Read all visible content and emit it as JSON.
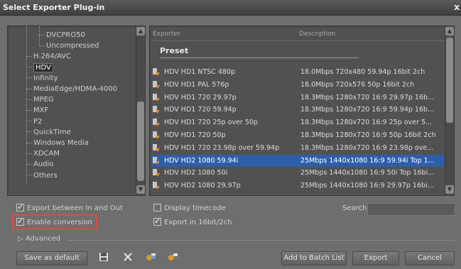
{
  "window": {
    "title": "Select Exporter Plug-in",
    "close": "x"
  },
  "tree": {
    "items": [
      {
        "label": "DVCPRO50",
        "level": 2
      },
      {
        "label": "Uncompressed",
        "level": 2
      },
      {
        "label": "H.264/AVC",
        "level": 1
      },
      {
        "label": "HDV",
        "level": 1,
        "selected": true
      },
      {
        "label": "Infinity",
        "level": 1
      },
      {
        "label": "MediaEdge/HDMA-4000",
        "level": 1
      },
      {
        "label": "MPEG",
        "level": 1
      },
      {
        "label": "MXF",
        "level": 1
      },
      {
        "label": "P2",
        "level": 1
      },
      {
        "label": "QuickTime",
        "level": 1
      },
      {
        "label": "Windows Media",
        "level": 1
      },
      {
        "label": "XDCAM",
        "level": 1
      },
      {
        "label": "Audio",
        "level": 1
      },
      {
        "label": "Others",
        "level": 1
      }
    ]
  },
  "list": {
    "col_exporter": "Exporter",
    "col_description": "Description",
    "group": "Preset",
    "rows": [
      {
        "name": "HDV HD1 NTSC 480p",
        "desc": "18.0Mbps 720x480 59.94p 16bit 2ch"
      },
      {
        "name": "HDV HD1 PAL 576p",
        "desc": "18.0Mbps 720x576 50p 16bit 2ch"
      },
      {
        "name": "HDV HD1 720 29.97p",
        "desc": "18.3Mbps 1280x720 16:9 29.97p 16b..."
      },
      {
        "name": "HDV HD1 720 59.94p",
        "desc": "18.3Mbps 1280x720 16:9 59.94p 16b..."
      },
      {
        "name": "HDV HD1 720 25p over 50p",
        "desc": "18.3Mbps 1280x720 16:9 25p over 5..."
      },
      {
        "name": "HDV HD1 720 50p",
        "desc": "18.3Mbps 1280x720 16:9 50p 16bit 2ch"
      },
      {
        "name": "HDV HD1 720 23.98p over 59.94p",
        "desc": "18.3Mbps 1280x720 16:9 23.98p ove..."
      },
      {
        "name": "HDV HD2 1080 59.94i",
        "desc": "25Mbps 1440x1080 16:9 59.94i Top 1...",
        "selected": true
      },
      {
        "name": "HDV HD2 1080 50i",
        "desc": "25Mbps 1440x1080 16:9 50i Top 16bi..."
      },
      {
        "name": "HDV HD2 1080 29.97p",
        "desc": "25Mbps 1440x1080 16:9 29.97p 16bi..."
      }
    ]
  },
  "options": {
    "export_in_out": {
      "label": "Export between In and Out",
      "checked": true
    },
    "enable_conversion": {
      "label": "Enable conversion",
      "checked": true
    },
    "display_timecode": {
      "label": "Display timecode",
      "checked": false
    },
    "export_16bit": {
      "label": "Export in 16bit/2ch",
      "checked": true
    },
    "search_label": "Search",
    "search_value": "",
    "advanced": "Advanced"
  },
  "buttons": {
    "save_default": "Save as default",
    "add_batch": "Add to Batch List",
    "export": "Export",
    "cancel": "Cancel"
  },
  "colors": {
    "selection": "#2f5ea9",
    "highlight": "#e04a3a"
  }
}
